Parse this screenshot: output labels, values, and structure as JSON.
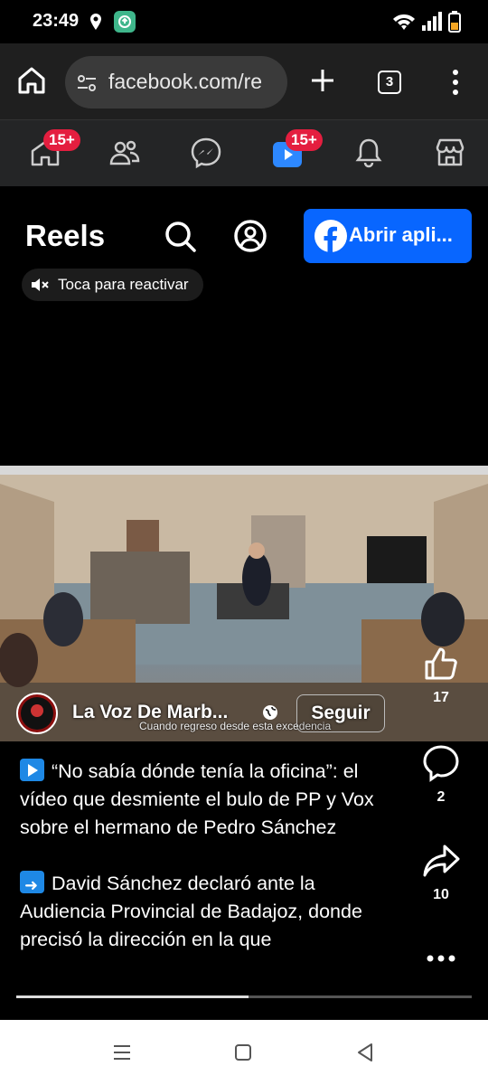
{
  "status_bar": {
    "time": "23:49"
  },
  "browser": {
    "url": "facebook.com/re",
    "tab_count": "3"
  },
  "fb_nav": {
    "items": [
      {
        "name": "home",
        "badge": "15+"
      },
      {
        "name": "friends",
        "badge": ""
      },
      {
        "name": "messenger",
        "badge": ""
      },
      {
        "name": "video",
        "badge": "15+"
      },
      {
        "name": "notifications",
        "badge": ""
      },
      {
        "name": "marketplace",
        "badge": ""
      }
    ]
  },
  "reels": {
    "title": "Reels",
    "open_app_label": "Abrir apli...",
    "mute_label": "Toca para reactivar"
  },
  "video": {
    "caption_overlay": "Cuando regreso desde esta excedencia",
    "author": "La Voz De Marb...",
    "follow_label": "Seguir",
    "progress": 0.51
  },
  "actions": {
    "likes": "17",
    "comments": "2",
    "shares": "10"
  },
  "post": {
    "paragraph1": "“No sabía dónde tenía la oficina”: el vídeo que desmiente el bulo de PP y Vox sobre el hermano de Pedro Sánchez",
    "paragraph2": "David Sánchez declaró ante la Audiencia Provincial de Badajoz, donde precisó la dirección en la que"
  },
  "colors": {
    "brand": "#0866ff",
    "badge": "#e41e3f"
  }
}
